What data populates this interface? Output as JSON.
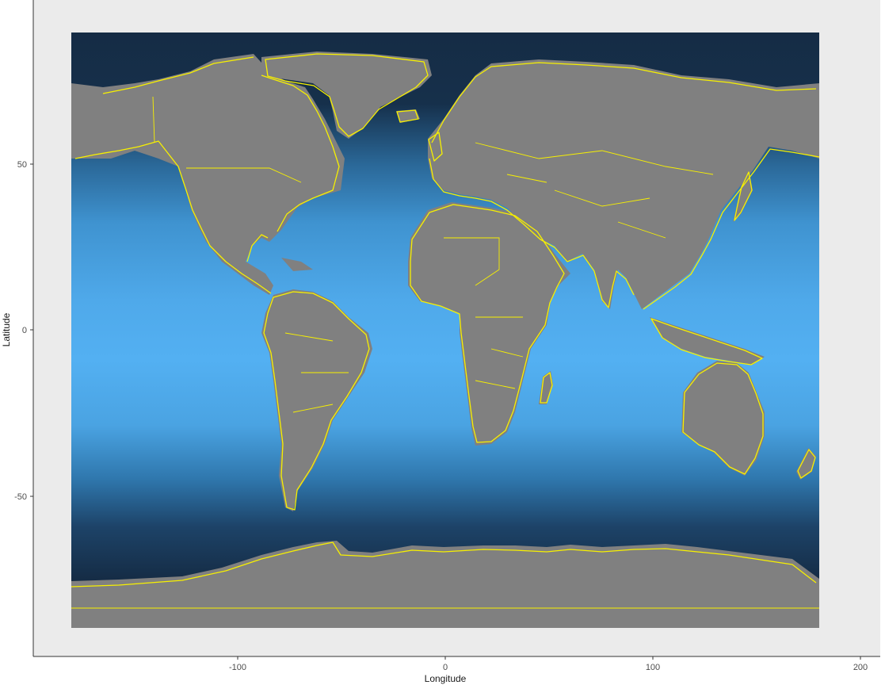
{
  "map": {
    "projection": "equirectangular longitude/latitude grid",
    "x_axis_label": "Longitude",
    "y_axis_label": "Latitude",
    "x_ticks": [
      "-100",
      "0",
      "100",
      "200"
    ],
    "y_ticks": [
      "50",
      "0",
      "-50"
    ],
    "x_tick_values": [
      -100,
      0,
      100,
      200
    ],
    "y_tick_values": [
      50,
      0,
      -50
    ],
    "xlim": [
      -180,
      180
    ],
    "ylim": [
      -90,
      90
    ],
    "panel_background": "#ebebeb",
    "land_color": "#808080",
    "boundary_color": "#f7f000",
    "ocean_gradient": [
      "#152c45",
      "#1f4b72",
      "#3a8cc9",
      "#53b0f2"
    ]
  }
}
